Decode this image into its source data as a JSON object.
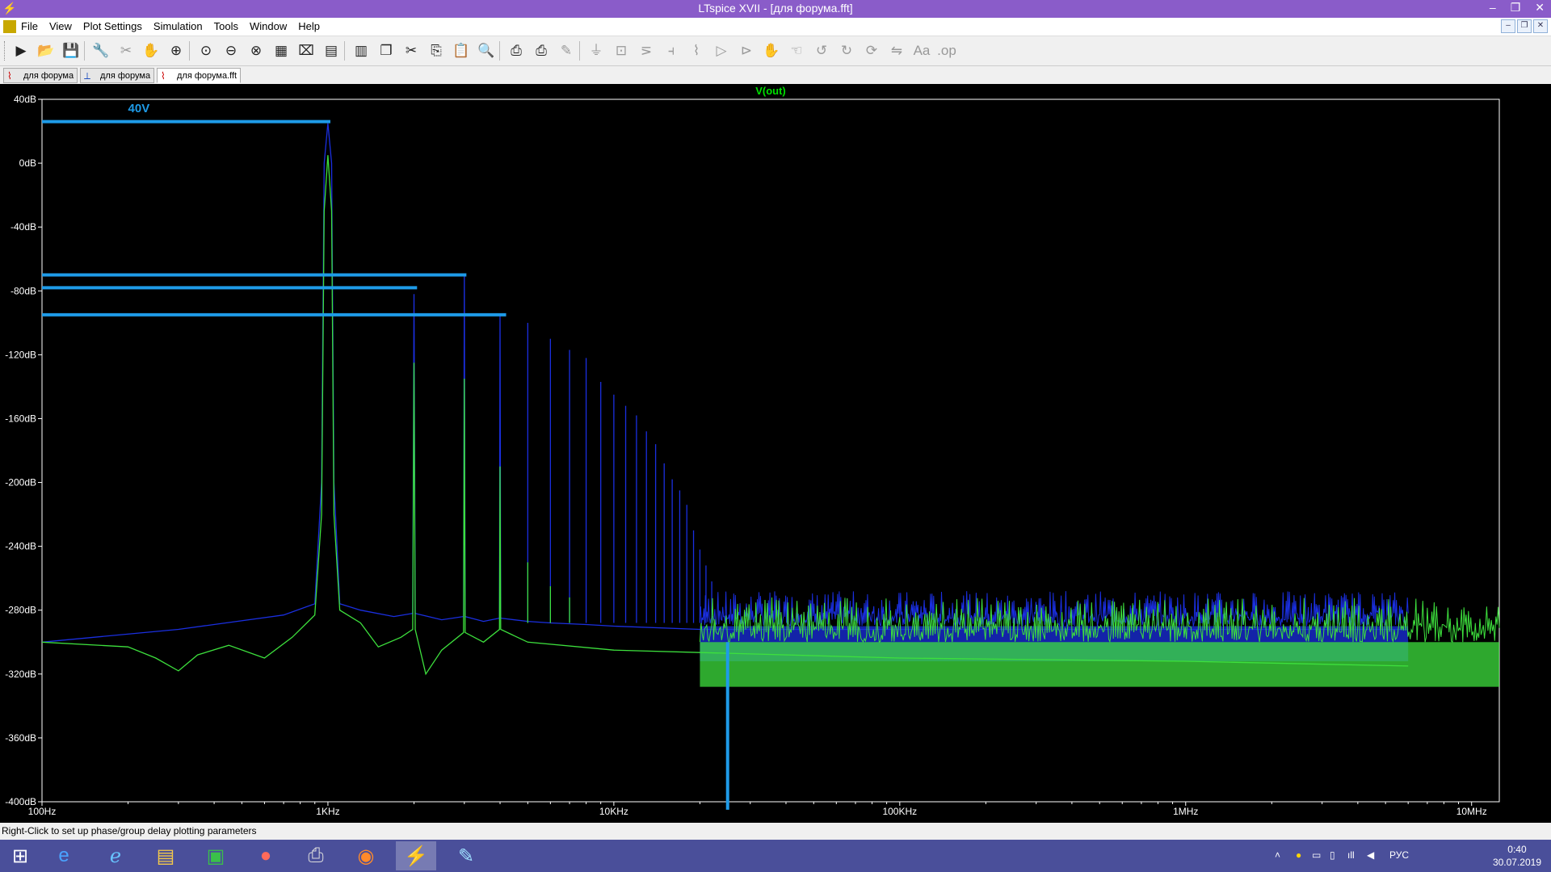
{
  "window": {
    "title": "LTspice XVII - [для форума.fft]",
    "minimize_glyph": "–",
    "restore_glyph": "❐",
    "close_glyph": "✕"
  },
  "menu": [
    "File",
    "View",
    "Plot Settings",
    "Simulation",
    "Tools",
    "Window",
    "Help"
  ],
  "mdi_controls": [
    "–",
    "❐",
    "✕"
  ],
  "toolbar_icons": [
    "run-icon",
    "open-icon",
    "save-icon",
    "control-panel-icon",
    "halt-icon",
    "pan-icon",
    "zoom-in-icon",
    "zoom-area-icon",
    "zoom-out-icon",
    "zoom-fit-icon",
    "autorange-icon",
    "mark-data-icon",
    "tile-h-icon",
    "tile-v-icon",
    "cascade-icon",
    "cut-icon",
    "copy-icon",
    "paste-icon",
    "find-icon",
    "print-icon",
    "print-setup-icon",
    "draw-wire-icon",
    "ground-icon",
    "label-icon",
    "resistor-icon",
    "capacitor-icon",
    "inductor-icon",
    "diode-icon",
    "component-icon",
    "move-icon",
    "drag-icon",
    "undo-icon",
    "redo-icon",
    "rotate-icon",
    "mirror-icon",
    "text-icon",
    "spice-directive-icon"
  ],
  "tabs": [
    {
      "label": "для форума",
      "icon": "waveform-icon"
    },
    {
      "label": "для форума",
      "icon": "schematic-icon"
    },
    {
      "label": "для форума.fft",
      "icon": "fft-icon"
    }
  ],
  "statusbar": "Right-Click to set up phase/group delay plotting parameters",
  "taskbar": {
    "apps": [
      "start-icon",
      "edge-icon",
      "ie-icon",
      "explorer-icon",
      "store-icon",
      "paint-icon",
      "printer-icon",
      "firefox-icon",
      "ltspice-icon",
      "paint3d-icon"
    ],
    "lang": "РУС",
    "time": "0:40",
    "date": "30.07.2019"
  },
  "chart_data": {
    "type": "line",
    "title": "V(out)",
    "xlabel": "",
    "ylabel": "",
    "xscale": "log",
    "xlim": [
      100,
      12500000
    ],
    "ylim": [
      -400,
      40
    ],
    "x_ticks": [
      {
        "value": 100,
        "label": "100Hz"
      },
      {
        "value": 1000,
        "label": "1KHz"
      },
      {
        "value": 10000,
        "label": "10KHz"
      },
      {
        "value": 100000,
        "label": "100KHz"
      },
      {
        "value": 1000000,
        "label": "1MHz"
      },
      {
        "value": 10000000,
        "label": "10MHz"
      }
    ],
    "y_ticks": [
      {
        "value": 40,
        "label": "40dB"
      },
      {
        "value": 0,
        "label": "0dB"
      },
      {
        "value": -40,
        "label": "-40dB"
      },
      {
        "value": -80,
        "label": "-80dB"
      },
      {
        "value": -120,
        "label": "-120dB"
      },
      {
        "value": -160,
        "label": "-160dB"
      },
      {
        "value": -200,
        "label": "-200dB"
      },
      {
        "value": -240,
        "label": "-240dB"
      },
      {
        "value": -280,
        "label": "-280dB"
      },
      {
        "value": -320,
        "label": "-320dB"
      },
      {
        "value": -360,
        "label": "-360dB"
      },
      {
        "value": -400,
        "label": "-400dB"
      }
    ],
    "grid": false,
    "colors": {
      "background": "#000000",
      "axis": "#ffffff",
      "title": "#00e000",
      "series_blue": "#1a2fe0",
      "series_green": "#3de03d",
      "annotation": "#1e9be8"
    },
    "series": [
      {
        "color": "#1a2fe0",
        "points": [
          [
            100,
            -300
          ],
          [
            300,
            -292
          ],
          [
            700,
            -283
          ],
          [
            900,
            -276
          ],
          [
            950,
            -200
          ],
          [
            970,
            0
          ],
          [
            1000,
            25
          ],
          [
            1030,
            0
          ],
          [
            1050,
            -200
          ],
          [
            1100,
            -276
          ],
          [
            1300,
            -280
          ],
          [
            1700,
            -284
          ],
          [
            1980,
            -282
          ],
          [
            2000,
            -82
          ],
          [
            2020,
            -282
          ],
          [
            2500,
            -286
          ],
          [
            2980,
            -284
          ],
          [
            3000,
            -70
          ],
          [
            3020,
            -284
          ],
          [
            3500,
            -287
          ],
          [
            3980,
            -285
          ],
          [
            4000,
            -95
          ],
          [
            4020,
            -285
          ],
          [
            5000,
            -287
          ],
          [
            6000,
            -288
          ],
          [
            8000,
            -289
          ],
          [
            10000,
            -290
          ],
          [
            20000,
            -292
          ],
          [
            100000,
            -292
          ],
          [
            1000000,
            -292
          ],
          [
            6000000,
            -292
          ]
        ],
        "harmonics": [
          [
            5000,
            -100
          ],
          [
            6000,
            -110
          ],
          [
            7000,
            -117
          ],
          [
            8000,
            -122
          ],
          [
            9000,
            -137
          ],
          [
            10000,
            -145
          ],
          [
            11000,
            -152
          ],
          [
            12000,
            -158
          ],
          [
            13000,
            -168
          ],
          [
            14000,
            -176
          ],
          [
            15000,
            -188
          ],
          [
            16000,
            -198
          ],
          [
            17000,
            -205
          ],
          [
            18000,
            -214
          ],
          [
            19000,
            -230
          ],
          [
            20000,
            -242
          ],
          [
            21000,
            -252
          ],
          [
            22000,
            -262
          ]
        ],
        "noise_band": {
          "from": 20000,
          "to": 6000000,
          "top": -290,
          "bottom": -312
        }
      },
      {
        "color": "#3de03d",
        "points": [
          [
            100,
            -300
          ],
          [
            200,
            -303
          ],
          [
            250,
            -310
          ],
          [
            300,
            -318
          ],
          [
            350,
            -308
          ],
          [
            450,
            -302
          ],
          [
            600,
            -310
          ],
          [
            750,
            -297
          ],
          [
            900,
            -283
          ],
          [
            950,
            -220
          ],
          [
            970,
            -30
          ],
          [
            1000,
            5
          ],
          [
            1030,
            -30
          ],
          [
            1050,
            -220
          ],
          [
            1100,
            -280
          ],
          [
            1300,
            -288
          ],
          [
            1500,
            -303
          ],
          [
            1800,
            -297
          ],
          [
            1980,
            -292
          ],
          [
            2000,
            -125
          ],
          [
            2020,
            -292
          ],
          [
            2200,
            -320
          ],
          [
            2500,
            -305
          ],
          [
            2980,
            -294
          ],
          [
            3000,
            -135
          ],
          [
            3020,
            -294
          ],
          [
            3500,
            -300
          ],
          [
            3980,
            -292
          ],
          [
            4000,
            -190
          ],
          [
            4020,
            -292
          ],
          [
            5000,
            -300
          ],
          [
            10000,
            -305
          ],
          [
            100000,
            -310
          ],
          [
            1000000,
            -312
          ],
          [
            6000000,
            -315
          ]
        ],
        "harmonics": [
          [
            5000,
            -250
          ],
          [
            6000,
            -265
          ],
          [
            7000,
            -272
          ]
        ],
        "noise_band": {
          "from": 20000,
          "to": 12500000,
          "top": -300,
          "bottom": -328
        }
      }
    ],
    "annotations": [
      {
        "text": "40V",
        "x": 200,
        "y": 32
      },
      {
        "type": "hline",
        "y": 26,
        "x_from": 100,
        "x_to": 1020
      },
      {
        "type": "hline",
        "y": -70,
        "x_from": 100,
        "x_to": 3050
      },
      {
        "type": "hline",
        "y": -78,
        "x_from": 100,
        "x_to": 2050
      },
      {
        "type": "hline",
        "y": -95,
        "x_from": 100,
        "x_to": 4200
      },
      {
        "type": "vline",
        "x": 25000,
        "y_from": -300,
        "y_to": -405
      }
    ]
  }
}
